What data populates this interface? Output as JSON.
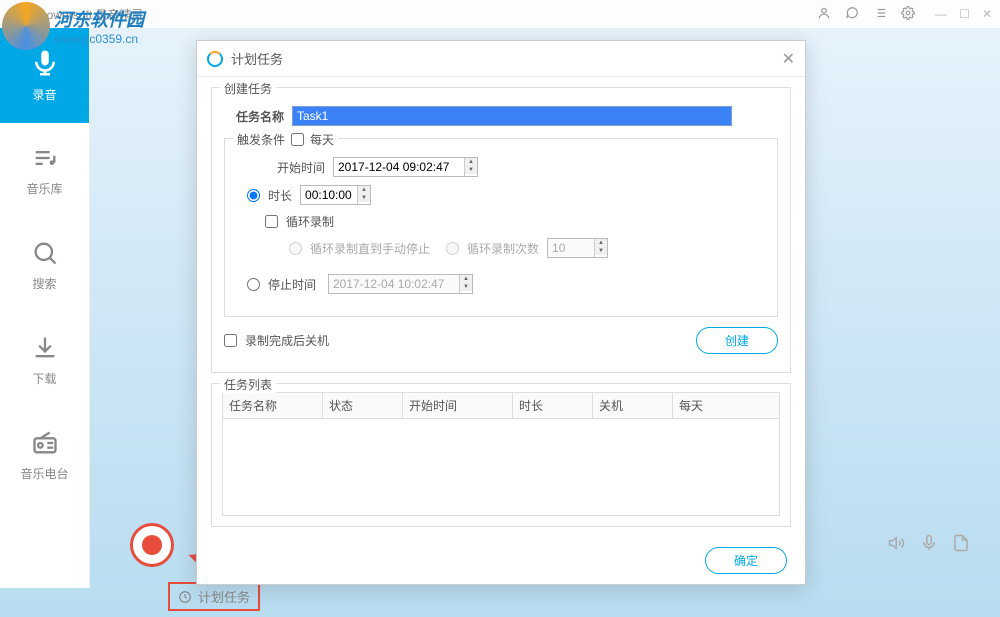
{
  "app": {
    "title": "Apowersoft 录音精灵"
  },
  "watermark": {
    "title": "河东软件园",
    "url": "www.pc0359.cn"
  },
  "sidebar": {
    "items": [
      {
        "label": "录音",
        "icon": "mic-icon"
      },
      {
        "label": "音乐库",
        "icon": "library-icon"
      },
      {
        "label": "搜索",
        "icon": "search-icon"
      },
      {
        "label": "下载",
        "icon": "download-icon"
      },
      {
        "label": "音乐电台",
        "icon": "radio-icon"
      }
    ]
  },
  "dialog": {
    "title": "计划任务",
    "create_section": "创建任务",
    "task_name_label": "任务名称",
    "task_name_value": "Task1",
    "trigger_label": "触发条件",
    "daily_label": "每天",
    "start_time_label": "开始时间",
    "start_time_value": "2017-12-04 09:02:47",
    "duration_label": "时长",
    "duration_value": "00:10:00",
    "loop_record_label": "循环录制",
    "loop_until_stop_label": "循环录制直到手动停止",
    "loop_count_label": "循环录制次数",
    "loop_count_value": "10",
    "stop_time_label": "停止时间",
    "stop_time_value": "2017-12-04 10:02:47",
    "shutdown_label": "录制完成后关机",
    "create_btn": "创建",
    "task_list_label": "任务列表",
    "columns": {
      "name": "任务名称",
      "status": "状态",
      "start": "开始时间",
      "duration": "时长",
      "shutdown": "关机",
      "daily": "每天"
    },
    "ok_btn": "确定"
  },
  "bottom": {
    "schedule_label": "计划任务"
  }
}
